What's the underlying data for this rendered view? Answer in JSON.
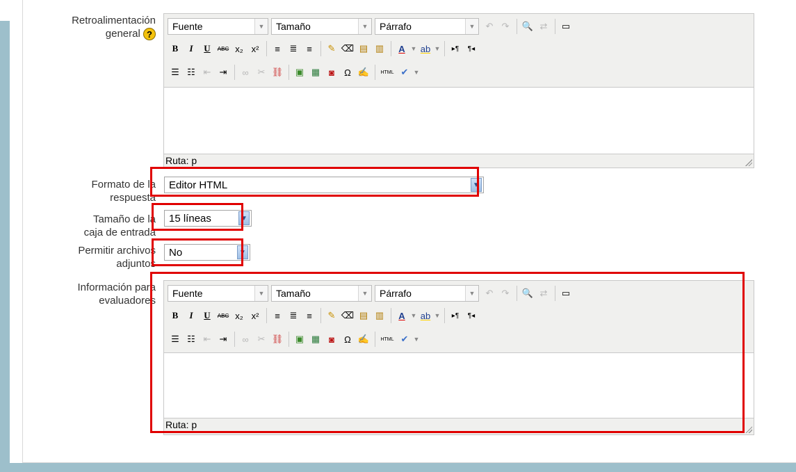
{
  "fields": {
    "feedback_label_1": "Retroalimentación",
    "feedback_label_2": "general",
    "format_label_1": "Formato de la",
    "format_label_2": "respuesta",
    "size_label_1": "Tamaño de la",
    "size_label_2": "caja de entrada",
    "attach_label_1": "Permitir archivos",
    "attach_label_2": "adjuntos",
    "info_label_1": "Información para",
    "info_label_2": "evaluadores"
  },
  "editor": {
    "font_select": "Fuente",
    "size_select": "Tamaño",
    "paragraph_select": "Párrafo",
    "path_label": "Ruta: p",
    "bold": "B",
    "italic": "I",
    "underline": "U",
    "strike": "ABC",
    "omega": "Ω",
    "html": "HTML",
    "text_color": "A",
    "help_glyph": "?"
  },
  "selects": {
    "response_format": "Editor HTML",
    "box_size": "15 líneas",
    "attachments": "No"
  },
  "colors": {
    "highlight": "#e00000",
    "frame": "#9dbfcb"
  }
}
